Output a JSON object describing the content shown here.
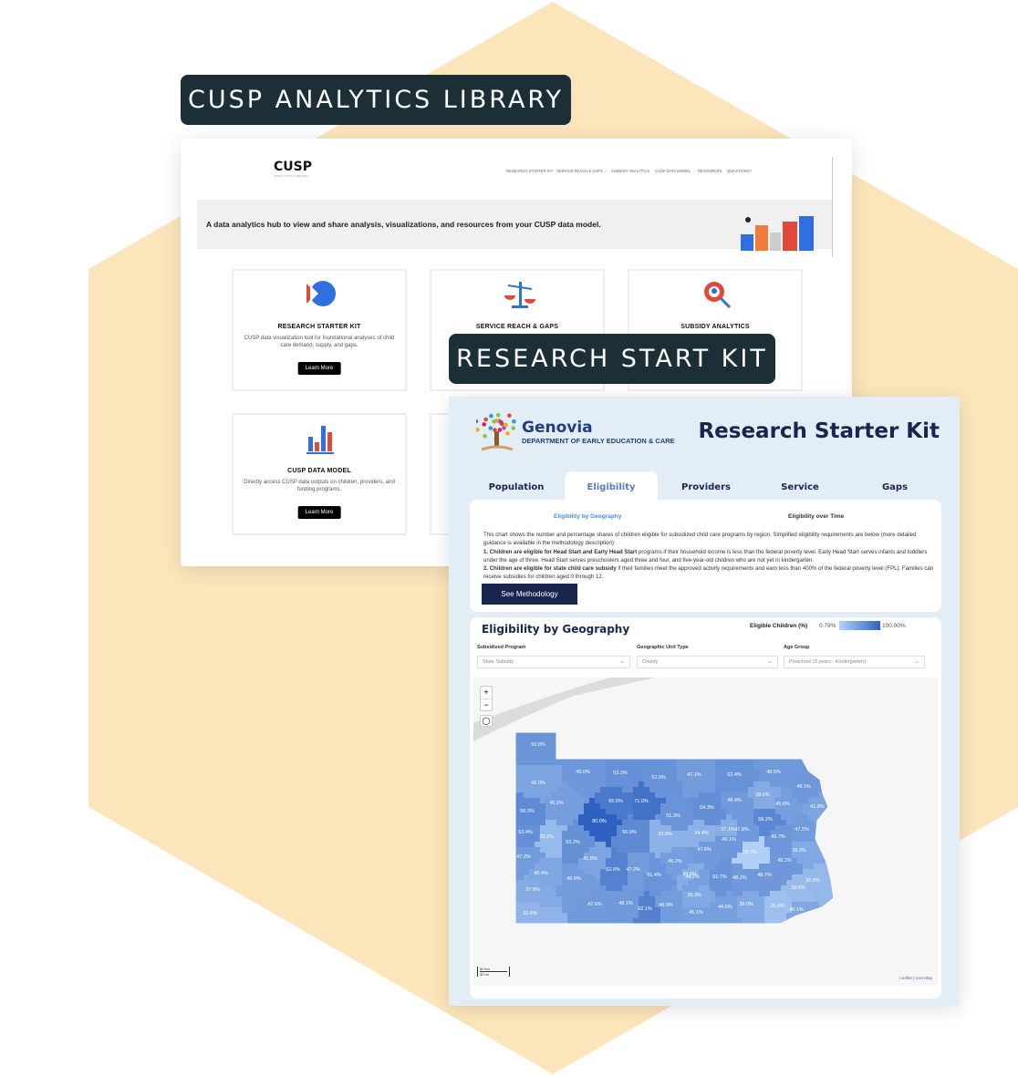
{
  "colors": {
    "hexagon": "#fde5bb",
    "tag_bg": "#1c2e36",
    "navy": "#1a2550",
    "accent_blue": "#4a8ae8",
    "map_low": "#b4d3f8",
    "map_high": "#2f62c0"
  },
  "tags": {
    "library": "CUSP ANALYTICS LIBRARY",
    "kit": "RESEARCH START KIT"
  },
  "library": {
    "logo": {
      "text": "CUSP",
      "sub": "ANALYTICS LIBRARY"
    },
    "nav": [
      "RESEARCH STARTER KIT",
      "SERVICE REACH & GAPS ⌄",
      "SUBSIDY ANALYTICS",
      "CUSP DATA MODEL",
      "RESOURCES",
      "QUESTIONS?"
    ],
    "banner": "A data analytics hub to view and share analysis, visualizations, and resources from your CUSP data model.",
    "cards": [
      {
        "icon": "play-pie-icon",
        "title": "RESEARCH STARTER KIT",
        "desc": "CUSP data visualization tool for foundational analyses of child care demand, supply, and gaps.",
        "button": "Learn More"
      },
      {
        "icon": "scales-icon",
        "title": "SERVICE REACH & GAPS",
        "desc": "",
        "button": ""
      },
      {
        "icon": "gear-search-icon",
        "title": "SUBSIDY ANALYTICS",
        "desc": "",
        "button": ""
      },
      {
        "icon": "bar-chart-icon",
        "title": "CUSP DATA MODEL",
        "desc": "Directly access CUSP data outputs on children, providers, and funding programs.",
        "button": "Learn More"
      }
    ]
  },
  "kit": {
    "org": "Genovia",
    "dept": "DEPARTMENT OF EARLY EDUCATION & CARE",
    "title": "Research Starter Kit",
    "tabs": [
      "Population",
      "Eligibility",
      "Providers",
      "Service",
      "Gaps"
    ],
    "active_tab": "Eligibility",
    "subtabs": [
      "Eligibility by Geography",
      "Eligibility over Time"
    ],
    "desc_intro": "This chart shows the number and percentage shares of children eligible for subsidized child care programs by region. Simplified eligibility requirements are below (more detailed guidance is available in the methodology description):",
    "rule1_bold": "1. Children are eligible for Head Start and Early Head Start",
    "rule1": " programs if their household income is less than the federal poverty level. Early Head Start serves infants and toddlers under the age of three. Head Start serves preschoolers aged three and four, and five-year-old children who are not yet in kindergarten.",
    "rule2_bold": "2. Children are eligible for state child care subsidy",
    "rule2": " if their families meet the approved activity requirements and earn less than 400% of the federal poverty level (FPL). Families can receive subsidies for children aged 0 through 12.",
    "methodology_button": "See Methodology",
    "map_title": "Eligibility by Geography",
    "legend": {
      "label": "Eligible Children (%)",
      "min": "0.79%",
      "max": "100.00%"
    },
    "filters": [
      {
        "label": "Subsidized Program",
        "value": "State Subsidy"
      },
      {
        "label": "Geographic Unit Type",
        "value": "County"
      },
      {
        "label": "Age Group",
        "value": "Preschool (3 years - Kindergarten)"
      }
    ],
    "zoom_in": "+",
    "zoom_out": "−",
    "scale": {
      "km": "50 km",
      "mi": "30 mi"
    },
    "attribution": "Leaflet | Icon Map",
    "county_values": [
      50.8,
      49.0,
      53.3,
      52.0,
      47.1,
      52.4,
      48.5,
      42.0,
      49.1,
      45.2,
      66.5,
      71.0,
      38.6,
      48.4,
      45.6,
      41.8,
      56.3,
      54.3,
      51.3,
      80.0,
      58.2,
      53.4,
      29.2,
      56.9,
      33.9,
      34.4,
      37.1,
      47.8,
      47.2,
      53.2,
      49.1,
      49.7,
      47.2,
      16.7,
      47.6,
      39.2,
      41.8,
      45.2,
      49.2,
      62.0,
      47.2,
      36.8,
      44.2,
      51.4,
      51.7,
      48.2,
      48.7,
      40.4,
      46.6,
      30.8,
      37.8,
      28.6,
      39.3,
      47.6,
      48.1,
      62.1,
      46.9,
      45.1,
      44.6,
      39.0,
      26.0,
      40.1,
      32.8
    ]
  }
}
